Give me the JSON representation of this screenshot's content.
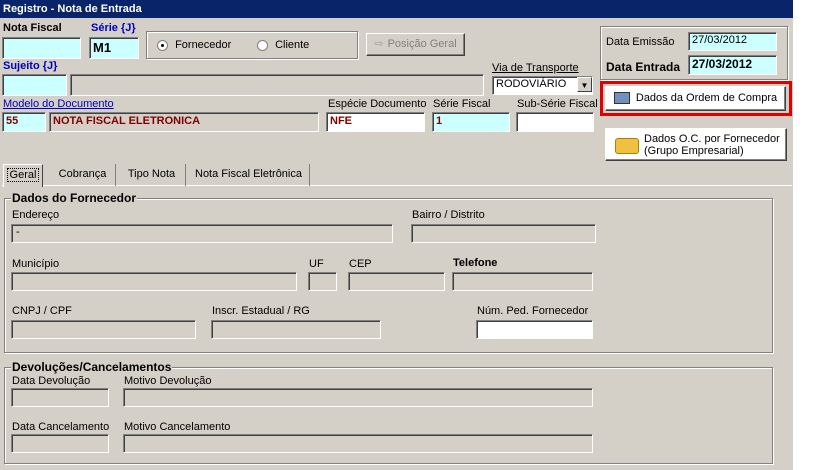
{
  "window": {
    "title": "Registro - Nota de Entrada"
  },
  "header": {
    "nota_fiscal_label": "Nota Fiscal",
    "nota_fiscal_value": "",
    "serie_label": "Série {J}",
    "serie_value": "M1",
    "fornecedor_label": "Fornecedor",
    "cliente_label": "Cliente",
    "selected_party": "Fornecedor",
    "posicao_geral_label": "Posição Geral",
    "sujeito_label": "Sujeito {J}",
    "sujeito_code": "",
    "sujeito_name": "",
    "via_transporte_label": "Via de Transporte",
    "via_transporte_value": "RODOVIÁRIO",
    "modelo_documento_label": "Modelo do Documento",
    "modelo_code": "55",
    "modelo_name": "NOTA FISCAL ELETRONICA",
    "especie_label": "Espécie Documento",
    "especie_value": "NFE",
    "serie_fiscal_label": "Série Fiscal",
    "serie_fiscal_value": "1",
    "sub_serie_label": "Sub-Série Fiscal",
    "sub_serie_value": ""
  },
  "dates": {
    "emissao_label": "Data Emissão",
    "emissao_value": "27/03/2012",
    "entrada_label": "Data Entrada",
    "entrada_value": "27/03/2012"
  },
  "buttons": {
    "ordem_compra": "Dados da Ordem de Compra",
    "oc_fornecedor_line1": "Dados O.C. por Fornecedor",
    "oc_fornecedor_line2": "(Grupo Empresarial)"
  },
  "tabs": [
    {
      "label": "Geral"
    },
    {
      "label": "Cobrança"
    },
    {
      "label": "Tipo Nota"
    },
    {
      "label": "Nota Fiscal Eletrônica"
    }
  ],
  "fornecedor": {
    "title": "Dados do Fornecedor",
    "endereco_label": "Endereço",
    "endereco_value": "-",
    "bairro_label": "Bairro / Distrito",
    "municipio_label": "Município",
    "uf_label": "UF",
    "cep_label": "CEP",
    "telefone_label": "Telefone",
    "cnpj_label": "CNPJ / CPF",
    "inscr_label": "Inscr. Estadual / RG",
    "num_ped_label": "Núm. Ped. Fornecedor"
  },
  "devolucoes": {
    "title": "Devoluções/Cancelamentos",
    "data_devolucao_label": "Data Devolução",
    "motivo_devolucao_label": "Motivo Devolução",
    "data_cancelamento_label": "Data Cancelamento",
    "motivo_cancelamento_label": "Motivo Cancelamento"
  }
}
